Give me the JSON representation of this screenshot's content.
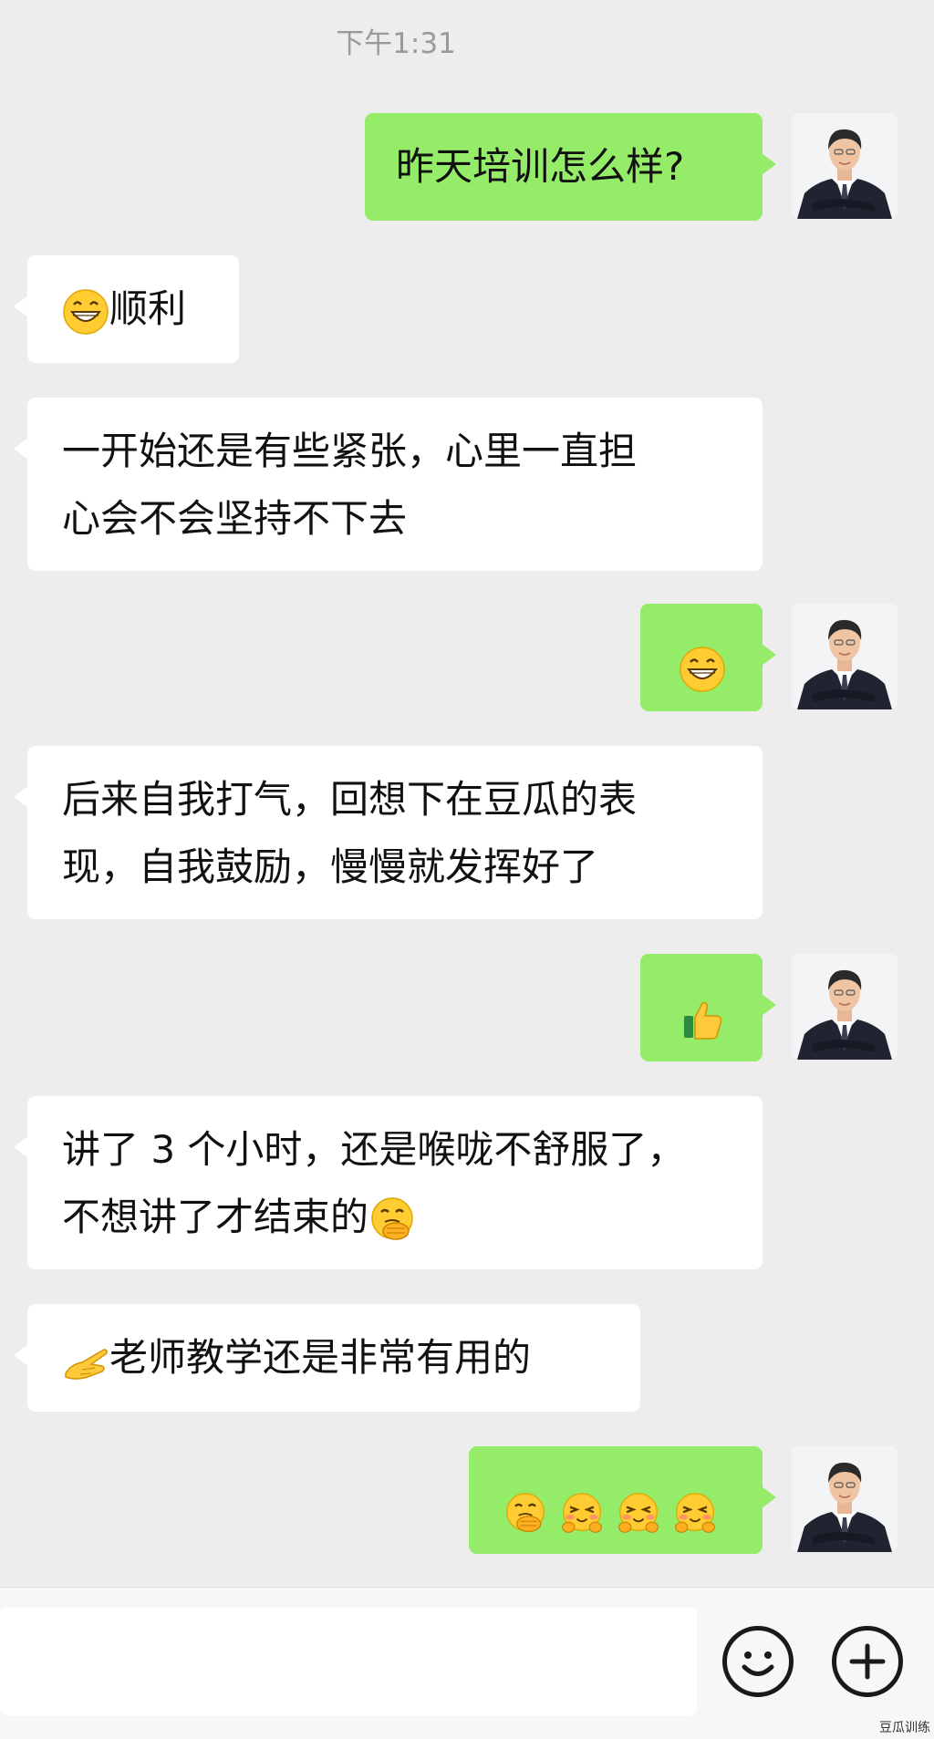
{
  "header": {
    "timestamp": "下午1:31"
  },
  "colors": {
    "background": "#ededed",
    "outgoing_bubble": "#95ec69",
    "incoming_bubble": "#ffffff"
  },
  "messages": [
    {
      "direction": "outgoing",
      "text": "昨天培训怎么样?"
    },
    {
      "direction": "incoming",
      "emoji": "grinning-emoji",
      "text": "顺利"
    },
    {
      "direction": "incoming",
      "lines": [
        "一开始还是有些紧张，心里一直担",
        "心会不会坚持不下去"
      ]
    },
    {
      "direction": "outgoing",
      "emoji": "grinning-emoji"
    },
    {
      "direction": "incoming",
      "lines": [
        "后来自我打气，回想下在豆瓜的表",
        "现，自我鼓励，慢慢就发挥好了"
      ]
    },
    {
      "direction": "outgoing",
      "emoji": "thumbs-up-emoji"
    },
    {
      "direction": "incoming",
      "lines": [
        "讲了 3 个小时，还是喉咙不舒服了，",
        "不想讲了才结束的"
      ],
      "trailing_emoji": "hand-over-mouth-emoji"
    },
    {
      "direction": "incoming",
      "emoji": "pointing-hand-emoji",
      "text": "老师教学还是非常有用的"
    },
    {
      "direction": "outgoing",
      "emojis": [
        "hand-over-mouth-emoji",
        "laughing-emoji",
        "laughing-emoji",
        "laughing-emoji"
      ]
    }
  ],
  "input_bar": {
    "message_value": "",
    "emoji_button_icon": "smiley-face-icon",
    "more_button_icon": "plus-circle-icon"
  },
  "watermark": "豆瓜训练"
}
